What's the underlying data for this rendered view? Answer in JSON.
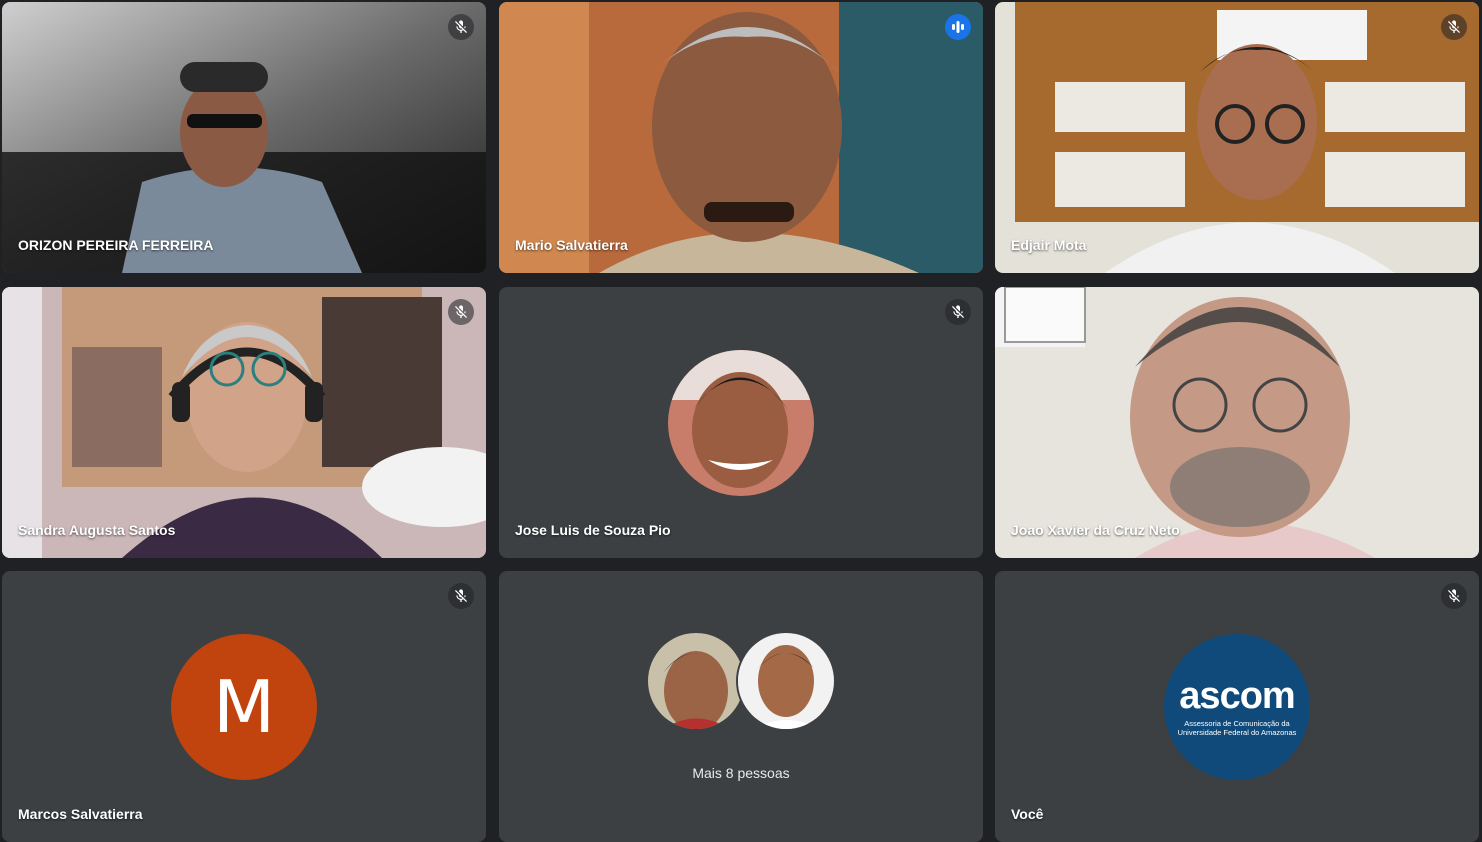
{
  "participants": [
    {
      "name": "ORIZON PEREIRA FERREIRA",
      "muted": true
    },
    {
      "name": "Mario Salvatierra",
      "muted": false,
      "speaking": true
    },
    {
      "name": "Edjair Mota",
      "muted": true
    },
    {
      "name": "Sandra Augusta Santos",
      "muted": true
    },
    {
      "name": "Jose Luis de Souza Pio",
      "muted": true
    },
    {
      "name": "Joao Xavier da Cruz Neto",
      "muted": false
    },
    {
      "name": "Marcos Salvatierra",
      "muted": true,
      "avatar_letter": "M",
      "avatar_color": "#c1440e"
    },
    {
      "more_label": "Mais 8 pessoas"
    },
    {
      "name": "Você",
      "muted": true,
      "avatar_logo_text": "ascom",
      "avatar_logo_subtitle": "Assessoria de Comunicação da Universidade Federal do Amazonas"
    }
  ],
  "colors": {
    "background": "#202124",
    "tile": "#3c4043",
    "speaking_border": "#8ab4f8",
    "active_mic": "#1a73e8",
    "ascom_blue": "#0f4a7a"
  },
  "icons": {
    "muted": "mic-off-icon",
    "speaking": "audio-levels-icon"
  }
}
